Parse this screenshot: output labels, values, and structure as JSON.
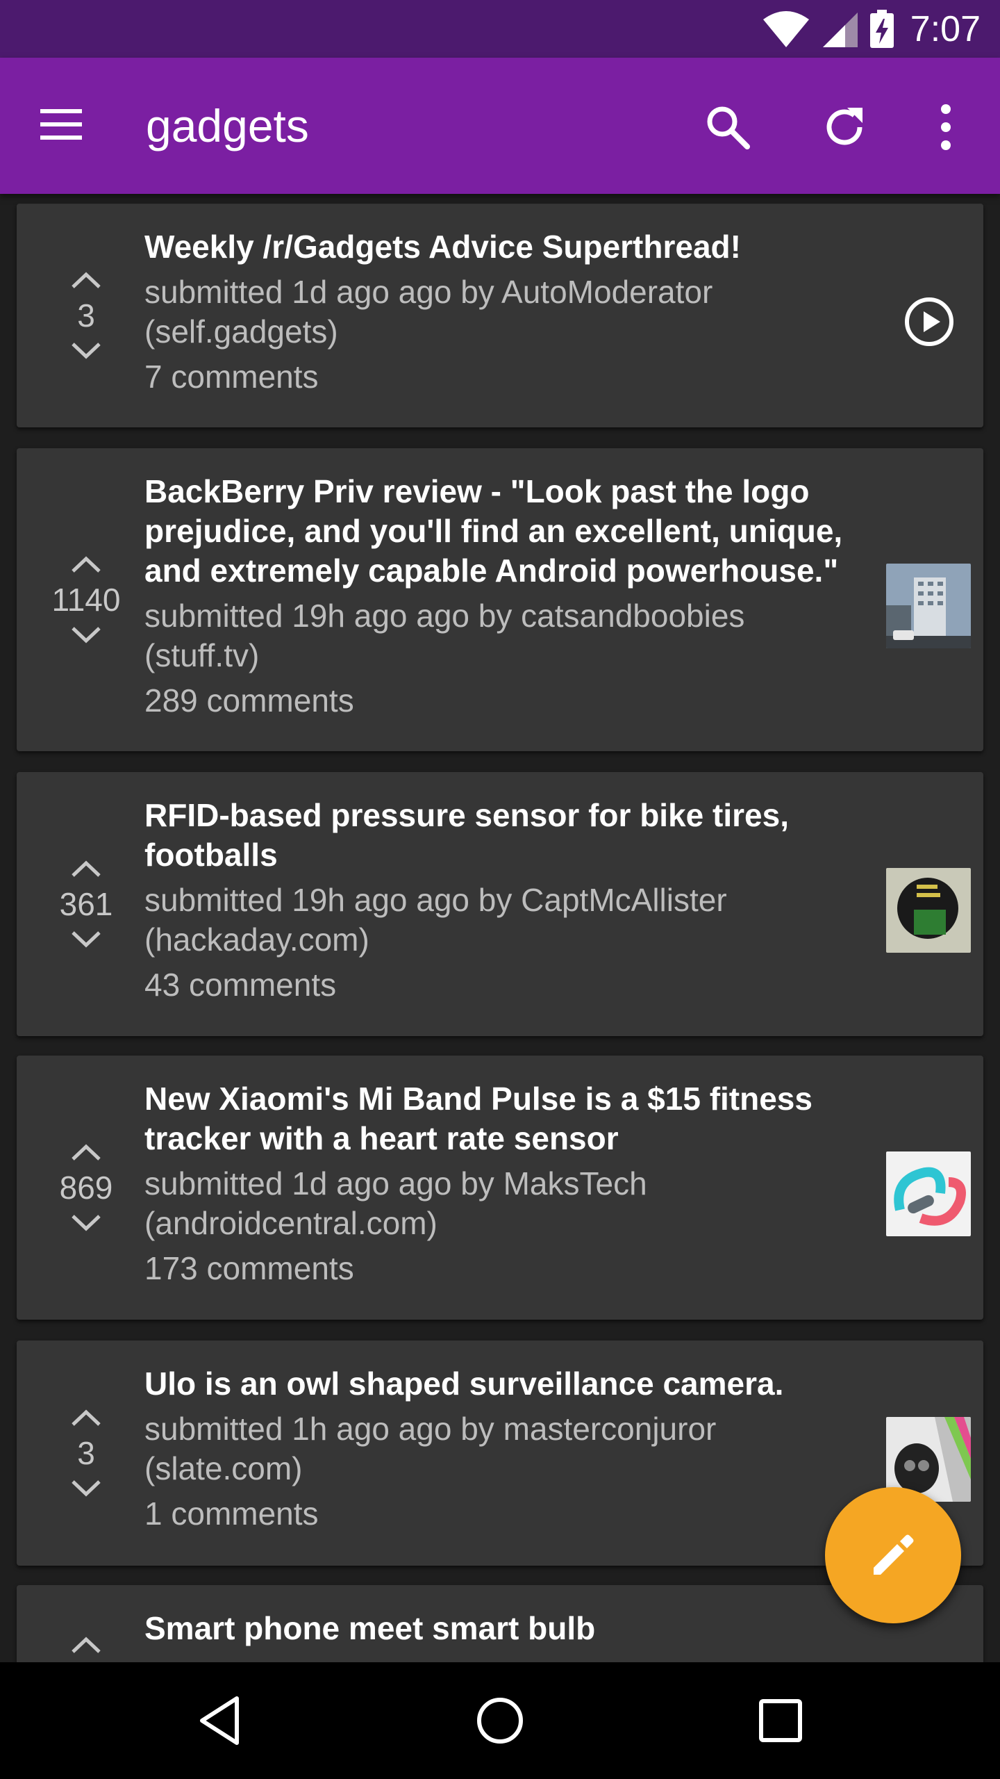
{
  "status_bar": {
    "time": "7:07",
    "icons": [
      "wifi-icon",
      "cell-signal-icon",
      "battery-charging-icon"
    ]
  },
  "toolbar": {
    "title": "gadgets",
    "icons": [
      "menu-icon",
      "search-icon",
      "refresh-icon",
      "overflow-menu-icon"
    ]
  },
  "posts": [
    {
      "score": "3",
      "title": "Weekly /r/Gadgets Advice Superthread!",
      "meta_line1": "submitted 1d ago ago by AutoModerator",
      "meta_line2": "(self.gadgets)",
      "comments": "7 comments",
      "thumb": "play-icon"
    },
    {
      "score": "1140",
      "title": "BackBerry Priv review - \"Look past the logo prejudice, and you'll find an excellent, unique, and extremely capable Android powerhouse.\"",
      "meta_line1": "submitted 19h ago ago by catsandboobies",
      "meta_line2": "(stuff.tv)",
      "comments": "289 comments",
      "thumb": "building-thumbnail"
    },
    {
      "score": "361",
      "title": "RFID-based pressure sensor for bike tires, footballs",
      "meta_line1": "submitted 19h ago ago by CaptMcAllister",
      "meta_line2": "(hackaday.com)",
      "comments": "43 comments",
      "thumb": "sensor-thumbnail"
    },
    {
      "score": "869",
      "title": "New Xiaomi's Mi Band Pulse is a $15 fitness tracker with a heart rate sensor",
      "meta_line1": "submitted 1d ago ago by MaksTech",
      "meta_line2": "(androidcentral.com)",
      "comments": "173 comments",
      "thumb": "fitness-band-thumbnail"
    },
    {
      "score": "3",
      "title": "Ulo is an owl shaped surveillance camera.",
      "meta_line1": "submitted 1h ago ago by masterconjuror",
      "meta_line2": "(slate.com)",
      "comments": "1 comments",
      "thumb": "owl-camera-thumbnail"
    },
    {
      "score": "",
      "title": "Smart phone meet smart bulb",
      "meta_line1": "",
      "meta_line2": "",
      "comments": "",
      "thumb": ""
    }
  ],
  "fab": {
    "icon": "edit-icon"
  },
  "nav_bar": {
    "icons": [
      "back-icon",
      "home-icon",
      "recents-icon"
    ]
  },
  "colors": {
    "status_bar": "#4c1a6e",
    "toolbar": "#7b1fa2",
    "card": "#363636",
    "background": "#1e1e1e",
    "fab": "#f5a623"
  }
}
